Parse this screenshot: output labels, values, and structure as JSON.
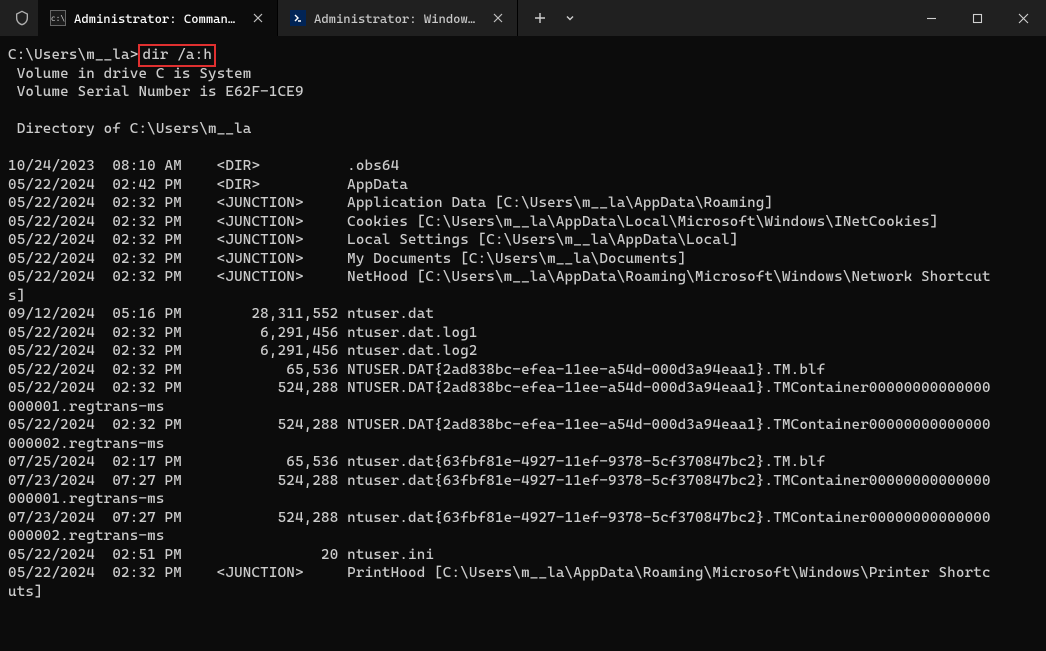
{
  "tabs": [
    {
      "label": "Administrator: Command Pro",
      "active": true
    },
    {
      "label": "Administrator: Windows Power",
      "active": false
    }
  ],
  "prompt": {
    "path": "C:\\Users\\m__la>",
    "command": "dir /a:h"
  },
  "output": {
    "header": [
      " Volume in drive C is System",
      " Volume Serial Number is E62F-1CE9",
      "",
      " Directory of C:\\Users\\m__la",
      ""
    ],
    "entries": [
      "10/24/2023  08:10 AM    <DIR>          .obs64",
      "05/22/2024  02:42 PM    <DIR>          AppData",
      "05/22/2024  02:32 PM    <JUNCTION>     Application Data [C:\\Users\\m__la\\AppData\\Roaming]",
      "05/22/2024  02:32 PM    <JUNCTION>     Cookies [C:\\Users\\m__la\\AppData\\Local\\Microsoft\\Windows\\INetCookies]",
      "05/22/2024  02:32 PM    <JUNCTION>     Local Settings [C:\\Users\\m__la\\AppData\\Local]",
      "05/22/2024  02:32 PM    <JUNCTION>     My Documents [C:\\Users\\m__la\\Documents]",
      "05/22/2024  02:32 PM    <JUNCTION>     NetHood [C:\\Users\\m__la\\AppData\\Roaming\\Microsoft\\Windows\\Network Shortcuts]",
      "09/12/2024  05:16 PM        28,311,552 ntuser.dat",
      "05/22/2024  02:32 PM         6,291,456 ntuser.dat.log1",
      "05/22/2024  02:32 PM         6,291,456 ntuser.dat.log2",
      "05/22/2024  02:32 PM            65,536 NTUSER.DAT{2ad838bc-efea-11ee-a54d-000d3a94eaa1}.TM.blf",
      "05/22/2024  02:32 PM           524,288 NTUSER.DAT{2ad838bc-efea-11ee-a54d-000d3a94eaa1}.TMContainer00000000000000000001.regtrans-ms",
      "05/22/2024  02:32 PM           524,288 NTUSER.DAT{2ad838bc-efea-11ee-a54d-000d3a94eaa1}.TMContainer00000000000000000002.regtrans-ms",
      "07/25/2024  02:17 PM            65,536 ntuser.dat{63fbf81e-4927-11ef-9378-5cf370847bc2}.TM.blf",
      "07/23/2024  07:27 PM           524,288 ntuser.dat{63fbf81e-4927-11ef-9378-5cf370847bc2}.TMContainer00000000000000000001.regtrans-ms",
      "07/23/2024  07:27 PM           524,288 ntuser.dat{63fbf81e-4927-11ef-9378-5cf370847bc2}.TMContainer00000000000000000002.regtrans-ms",
      "05/22/2024  02:51 PM                20 ntuser.ini",
      "05/22/2024  02:32 PM    <JUNCTION>     PrintHood [C:\\Users\\m__la\\AppData\\Roaming\\Microsoft\\Windows\\Printer Shortcuts]"
    ]
  }
}
